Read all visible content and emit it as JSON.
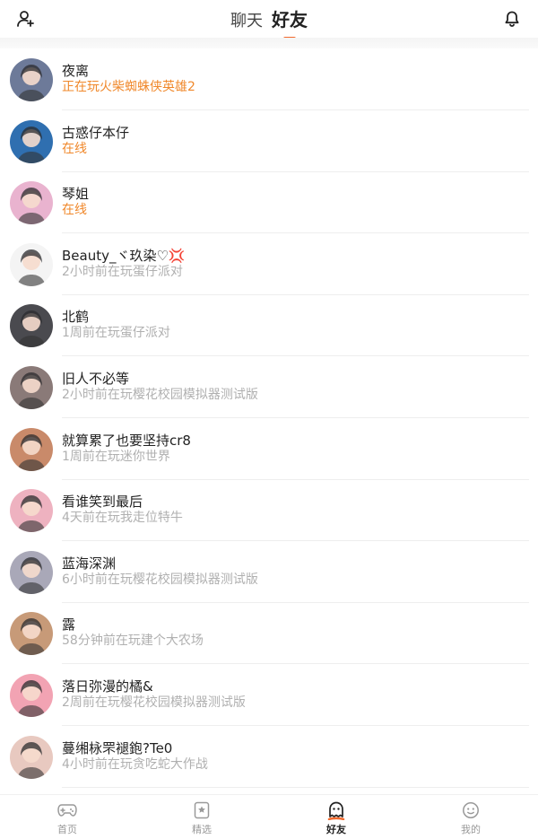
{
  "header": {
    "tabs": [
      {
        "label": "聊天"
      },
      {
        "label": "好友"
      }
    ],
    "left_icon": "add-friend-icon",
    "right_icon": "bell-icon"
  },
  "colors": {
    "accent": "#f26a2e",
    "online": "#f0882b",
    "muted": "#b0b0b0"
  },
  "friends": [
    {
      "name": "夜离",
      "status": "正在玩火柴蜘蛛侠英雄2",
      "online": true,
      "avatar_color": "#6d7a99"
    },
    {
      "name": "古惑仔本仔",
      "status": "在线",
      "online": true,
      "avatar_color": "#2f6fb0"
    },
    {
      "name": "琴姐",
      "status": "在线",
      "online": true,
      "avatar_color": "#e9b3cf"
    },
    {
      "name": "Beauty_ヾ玖染♡💢",
      "status": "2小时前在玩蛋仔派对",
      "online": false,
      "avatar_color": "#f4f4f4"
    },
    {
      "name": "北鹤",
      "status": "1周前在玩蛋仔派对",
      "online": false,
      "avatar_color": "#4a4a4f"
    },
    {
      "name": "旧人不必等",
      "status": "2小时前在玩樱花校园模拟器测试版",
      "online": false,
      "avatar_color": "#8a7a78"
    },
    {
      "name": "就算累了也要坚持cr8",
      "status": "1周前在玩迷你世界",
      "online": false,
      "avatar_color": "#c98a6a"
    },
    {
      "name": "看谁笑到最后",
      "status": "4天前在玩我走位特牛",
      "online": false,
      "avatar_color": "#eeb2c0"
    },
    {
      "name": "蓝海深渊",
      "status": "6小时前在玩樱花校园模拟器测试版",
      "online": false,
      "avatar_color": "#a9a8b8"
    },
    {
      "name": "露",
      "status": "58分钟前在玩建个大农场",
      "online": false,
      "avatar_color": "#c79a78"
    },
    {
      "name": "落日弥漫的橘&",
      "status": "2周前在玩樱花校园模拟器测试版",
      "online": false,
      "avatar_color": "#f2a3b3"
    },
    {
      "name": "蔓缃栐罘褪鉋?Te0",
      "status": "4小时前在玩贪吃蛇大作战",
      "online": false,
      "avatar_color": "#e8c9c0"
    }
  ],
  "bottom_nav": [
    {
      "label": "首页",
      "icon": "gamepad-icon"
    },
    {
      "label": "精选",
      "icon": "star-card-icon"
    },
    {
      "label": "好友",
      "icon": "ghost-icon"
    },
    {
      "label": "我的",
      "icon": "smiley-icon"
    }
  ]
}
